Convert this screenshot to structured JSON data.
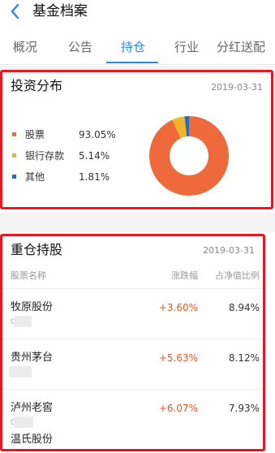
{
  "header": {
    "title": "基金档案",
    "back_icon": "chevron-left-icon"
  },
  "tabs": [
    {
      "label": "概况",
      "active": false
    },
    {
      "label": "公告",
      "active": false
    },
    {
      "label": "持仓",
      "active": true
    },
    {
      "label": "行业",
      "active": false
    },
    {
      "label": "分红送配",
      "active": false
    }
  ],
  "distribution": {
    "title": "投资分布",
    "date": "2019-03-31",
    "items": [
      {
        "name": "股票",
        "percent": "93.05%",
        "value": 93.05,
        "color": "#ee6a3c"
      },
      {
        "name": "银行存款",
        "percent": "5.14%",
        "value": 5.14,
        "color": "#f0b429"
      },
      {
        "name": "其他",
        "percent": "1.81%",
        "value": 1.81,
        "color": "#1f6fbf"
      }
    ]
  },
  "holdings": {
    "title": "重仓持股",
    "date": "2019-03-31",
    "columns": {
      "name": "股票名称",
      "change": "涨跌幅",
      "ratio": "占净值比例"
    },
    "rows": [
      {
        "name": "牧原股份",
        "code": "0   14",
        "change": "+3.60%",
        "ratio": "8.94%"
      },
      {
        "name": "贵州茅台",
        "code": "    19",
        "change": "+5.63%",
        "ratio": "8.12%"
      },
      {
        "name": "泸州老窖",
        "code": "0   8",
        "change": "+6.07%",
        "ratio": "7.93%"
      }
    ],
    "partial_row_name": "温氏股份"
  },
  "colors": {
    "accent": "#2d86e8",
    "highlight_box": "#e8191e",
    "up": "#e8541e"
  }
}
